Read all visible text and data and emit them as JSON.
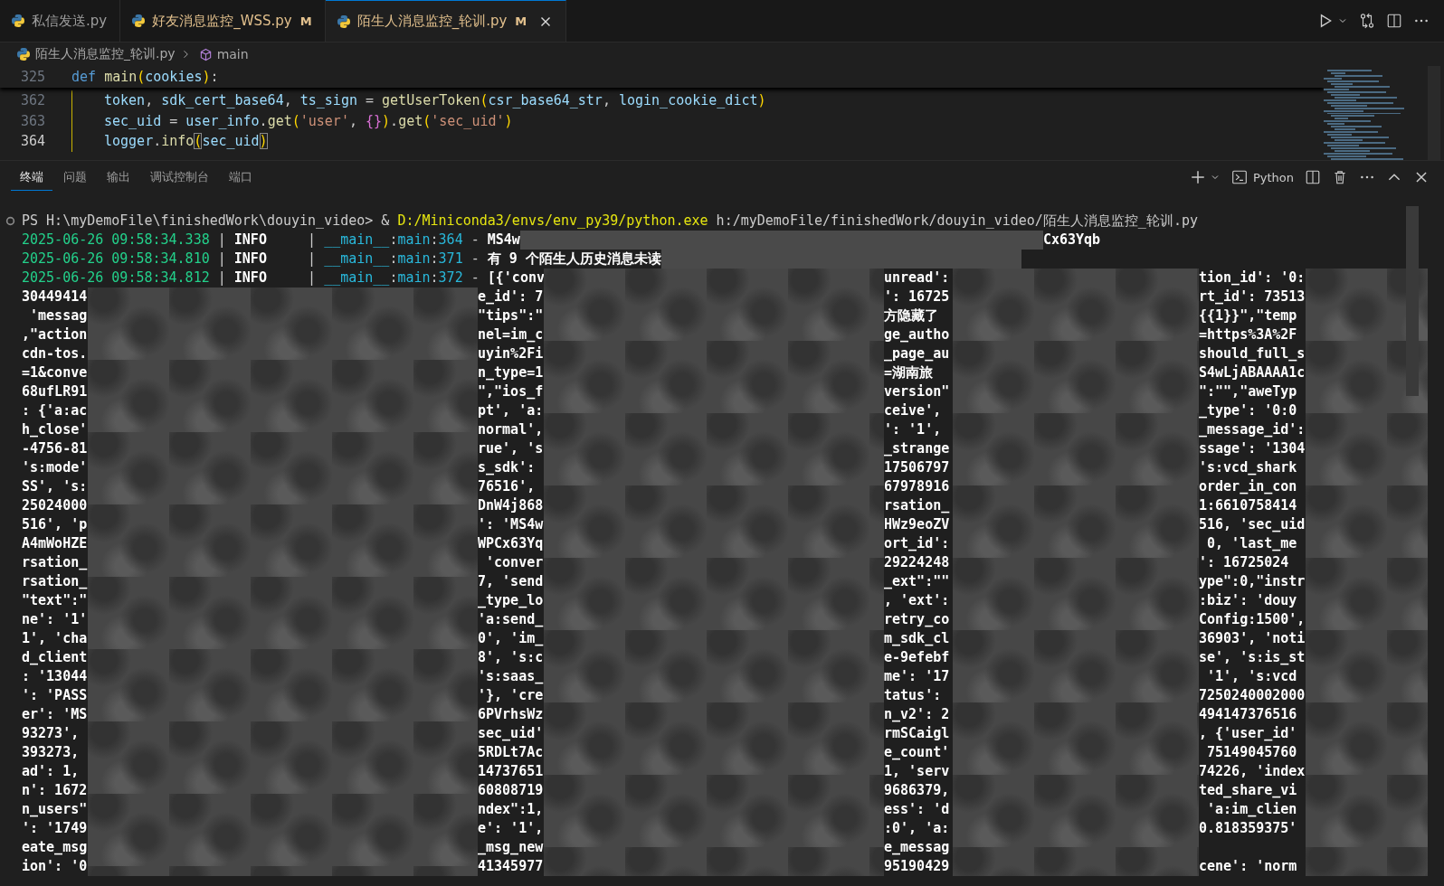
{
  "editor_tabs": [
    {
      "label": "私信发送.py",
      "selected": false
    },
    {
      "label": "好友消息监控_WSS.py",
      "badge": "M",
      "selected": false
    },
    {
      "label": "陌生人消息监控_轮训.py",
      "badge": "M",
      "selected": true
    }
  ],
  "breadcrumb": {
    "file": "陌生人消息监控_轮训.py",
    "symbol": "main"
  },
  "sticky_line": {
    "number": "325",
    "tokens": [
      {
        "text": "def ",
        "kind": "keyword"
      },
      {
        "text": "main",
        "kind": "function"
      },
      {
        "text": "(",
        "kind": "bracket1"
      },
      {
        "text": "cookies",
        "kind": "variable"
      },
      {
        "text": ")",
        "kind": "bracket1"
      },
      {
        "text": ":",
        "kind": "punct"
      }
    ]
  },
  "code_lines": [
    {
      "number": "362",
      "active": false,
      "tokens": [
        {
          "text": "token",
          "kind": "variable"
        },
        {
          "text": ", ",
          "kind": "punct"
        },
        {
          "text": "sdk_cert_base64",
          "kind": "variable"
        },
        {
          "text": ", ",
          "kind": "punct"
        },
        {
          "text": "ts_sign",
          "kind": "variable"
        },
        {
          "text": " = ",
          "kind": "punct"
        },
        {
          "text": "getUserToken",
          "kind": "function"
        },
        {
          "text": "(",
          "kind": "bracket1"
        },
        {
          "text": "csr_base64_str",
          "kind": "variable"
        },
        {
          "text": ", ",
          "kind": "punct"
        },
        {
          "text": "login_cookie_dict",
          "kind": "variable"
        },
        {
          "text": ")",
          "kind": "bracket1"
        }
      ]
    },
    {
      "number": "363",
      "active": false,
      "tokens": [
        {
          "text": "sec_uid",
          "kind": "variable"
        },
        {
          "text": " = ",
          "kind": "punct"
        },
        {
          "text": "user_info",
          "kind": "variable"
        },
        {
          "text": ".",
          "kind": "punct"
        },
        {
          "text": "get",
          "kind": "function"
        },
        {
          "text": "(",
          "kind": "bracket1"
        },
        {
          "text": "'user'",
          "kind": "string"
        },
        {
          "text": ", ",
          "kind": "punct"
        },
        {
          "text": "{}",
          "kind": "bracket2"
        },
        {
          "text": ")",
          "kind": "bracket1"
        },
        {
          "text": ".",
          "kind": "punct"
        },
        {
          "text": "get",
          "kind": "function"
        },
        {
          "text": "(",
          "kind": "bracket1"
        },
        {
          "text": "'sec_uid'",
          "kind": "string"
        },
        {
          "text": ")",
          "kind": "bracket1"
        }
      ]
    },
    {
      "number": "364",
      "active": true,
      "tokens": [
        {
          "text": "logger",
          "kind": "variable"
        },
        {
          "text": ".",
          "kind": "punct"
        },
        {
          "text": "info",
          "kind": "function"
        },
        {
          "text": "(",
          "kind": "matched"
        },
        {
          "text": "sec_uid",
          "kind": "variable"
        },
        {
          "text": ")",
          "kind": "matched"
        }
      ]
    }
  ],
  "panel_tabs": [
    {
      "label": "终端",
      "selected": true
    },
    {
      "label": "问题",
      "selected": false
    },
    {
      "label": "输出",
      "selected": false
    },
    {
      "label": "调试控制台",
      "selected": false
    },
    {
      "label": "端口",
      "selected": false
    }
  ],
  "terminal_profile": "Python",
  "terminal": {
    "lines": [
      {
        "redacted": false,
        "tokens": [
          {
            "text": "PS H:\\myDemoFile\\finishedWork\\douyin_video> & ",
            "kind": "plain"
          },
          {
            "text": "D:/Miniconda3/envs/env_py39/python.exe",
            "kind": "path"
          },
          {
            "text": " h:/myDemoFile/finishedWork/douyin_video/陌生人消息监控_轮训.py",
            "kind": "plain"
          }
        ]
      },
      {
        "redacted": true,
        "tail": "Cx63Yqb",
        "tokens": [
          {
            "text": "2025-06-26 09:58:34.338",
            "kind": "date"
          },
          {
            "text": " | ",
            "kind": "plain"
          },
          {
            "text": "INFO",
            "kind": "level"
          },
          {
            "text": "     | ",
            "kind": "plain"
          },
          {
            "text": "__main__",
            "kind": "module"
          },
          {
            "text": ":",
            "kind": "plain"
          },
          {
            "text": "main",
            "kind": "module"
          },
          {
            "text": ":",
            "kind": "plain"
          },
          {
            "text": "364",
            "kind": "module"
          },
          {
            "text": " - ",
            "kind": "plain"
          },
          {
            "text": "MS4w",
            "kind": "msg"
          }
        ]
      },
      {
        "redacted": true,
        "tokens": [
          {
            "text": "2025-06-26 09:58:34.810",
            "kind": "date"
          },
          {
            "text": " | ",
            "kind": "plain"
          },
          {
            "text": "INFO",
            "kind": "level"
          },
          {
            "text": "     | ",
            "kind": "plain"
          },
          {
            "text": "__main__",
            "kind": "module"
          },
          {
            "text": ":",
            "kind": "plain"
          },
          {
            "text": "main",
            "kind": "module"
          },
          {
            "text": ":",
            "kind": "plain"
          },
          {
            "text": "371",
            "kind": "module"
          },
          {
            "text": " - ",
            "kind": "plain"
          },
          {
            "text": "有 9 个陌生人历史消息未读",
            "kind": "msg"
          }
        ]
      }
    ],
    "first_row": {
      "c": "unread':",
      "d": "tion_id': '0:",
      "tokens": [
        {
          "text": "2025-06-26 09:58:34.812",
          "kind": "date"
        },
        {
          "text": " | ",
          "kind": "plain"
        },
        {
          "text": "INFO",
          "kind": "level"
        },
        {
          "text": "     | ",
          "kind": "plain"
        },
        {
          "text": "__main__",
          "kind": "module"
        },
        {
          "text": ":",
          "kind": "plain"
        },
        {
          "text": "main",
          "kind": "module"
        },
        {
          "text": ":",
          "kind": "plain"
        },
        {
          "text": "372",
          "kind": "module"
        },
        {
          "text": " - ",
          "kind": "plain"
        },
        {
          "text": "[{'conv",
          "kind": "msg"
        }
      ]
    },
    "rows": [
      {
        "a": "30449414",
        "b": "e_id': 7",
        "c": "': 16725",
        "d": "rt_id': 73513"
      },
      {
        "a": " 'messag",
        "b": "\"tips\":\"",
        "c": "方隐藏了",
        "d": "{{1}}\",\"temp"
      },
      {
        "a": ",\"action",
        "b": "nel=im_c",
        "c": "ge_autho",
        "d": "=https%3A%2F"
      },
      {
        "a": "cdn-tos.",
        "b": "uyin%2Fi",
        "c": "_page_au",
        "d": "should_full_s"
      },
      {
        "a": "=1&conve",
        "b": "n_type=1",
        "c": "=湖南旅",
        "d": "S4wLjABAAAA1c"
      },
      {
        "a": "68ufLR91",
        "b": "\",\"ios_f",
        "c": "version\"",
        "d": "\":\"\",\"aweTyp"
      },
      {
        "a": ": {'a:ac",
        "b": "pt', 'a:",
        "c": "ceive',",
        "d": "_type': '0:0"
      },
      {
        "a": "h_close'",
        "b": "normal',",
        "c": "': '1',",
        "d": "_message_id':"
      },
      {
        "a": "-4756-81",
        "b": "rue', 's",
        "c": "_strange",
        "d": "ssage': '1304"
      },
      {
        "a": "'s:mode'",
        "b": "s_sdk':",
        "c": "17506797",
        "d": "'s:vcd_shark"
      },
      {
        "a": "SS', 's:",
        "b": "76516',",
        "c": "67978916",
        "d": "order_in_con"
      },
      {
        "a": "25024000",
        "b": "DnW4j868",
        "c": "rsation_",
        "d": "1:6610758414"
      },
      {
        "a": "516', 'p",
        "b": "': 'MS4w",
        "c": "HWz9eoZV",
        "d": "516, 'sec_uid"
      },
      {
        "a": "A4mWoHZE",
        "b": "WPCx63Yq",
        "c": "ort_id':",
        "d": " 0, 'last_me"
      },
      {
        "a": "rsation_",
        "b": " 'conver",
        "c": "29224248",
        "d": "': 16725024"
      },
      {
        "a": "rsation_",
        "b": "7, 'send",
        "c": "_ext\":\"\"",
        "d": "ype\":0,\"instr"
      },
      {
        "a": "\"text\":\"",
        "b": "_type_lo",
        "c": ", 'ext':",
        "d": ":biz': 'douy"
      },
      {
        "a": "ne': '1'",
        "b": "'a:send_",
        "c": "retry_co",
        "d": "Config:1500',"
      },
      {
        "a": "1', 'cha",
        "b": "0', 'im_",
        "c": "m_sdk_cl",
        "d": "36903', 'noti"
      },
      {
        "a": "d_client",
        "b": "8', 's:c",
        "c": "e-9efebf",
        "d": "se', 's:is_st"
      },
      {
        "a": ": '13044",
        "b": "'s:saas_",
        "c": "me': '17",
        "d": " '1', 's:vcd"
      },
      {
        "a": "': 'PASS",
        "b": "'}, 'cre",
        "c": "tatus': ",
        "d": "7250240002000"
      },
      {
        "a": "er': 'MS",
        "b": "6PVrhsWz",
        "c": "n_v2': 2",
        "d": "494147376516"
      },
      {
        "a": "93273',",
        "b": "sec_uid'",
        "c": "rmSCaigl",
        "d": ", {'user_id'"
      },
      {
        "a": "393273,",
        "b": "5RDLt7Ac",
        "c": "e_count'",
        "d": " 75149045760"
      },
      {
        "a": "ad': 1,",
        "b": "14737651",
        "c": "1, 'serv",
        "d": "74226, 'index"
      },
      {
        "a": "n': 1672",
        "b": "60808719",
        "c": "9686379,",
        "d": "ted_share_vi"
      },
      {
        "a": "n_users\"",
        "b": "ndex\":1,",
        "c": "ess': 'd",
        "d": " 'a:im_clien"
      },
      {
        "a": "': '1749",
        "b": "e': '1',",
        "c": ":0', 'a:",
        "d": "0.818359375'"
      },
      {
        "a": "eate_msg",
        "b": "_msg_new",
        "c": "e_messag"
      },
      {
        "a": "ion': '0",
        "b": "41345977",
        "c": "95190429",
        "d": "cene': 'norm"
      }
    ]
  }
}
